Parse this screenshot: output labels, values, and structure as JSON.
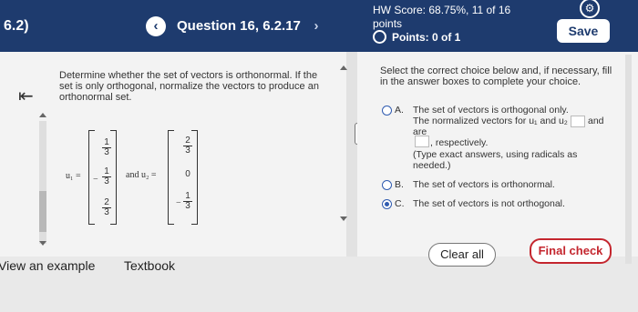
{
  "header": {
    "section_tag": "6.2)",
    "question_title": "Question 16, 6.2.17",
    "prev_label": "‹",
    "next_label": "›",
    "hw_score": "HW Score: 68.75%, 11 of 16 points",
    "points": "Points: 0 of 1",
    "save_label": "Save"
  },
  "left": {
    "instruction": "Determine whether the set of vectors is orthonormal. If the set is only orthogonal, normalize the vectors to produce an orthonormal set.",
    "u1_label": "u₁ =",
    "and_label": "and u₂ =",
    "u1": [
      {
        "sign": "",
        "num": "1",
        "den": "3"
      },
      {
        "sign": "−",
        "num": "1",
        "den": "3"
      },
      {
        "sign": "",
        "num": "2",
        "den": "3"
      }
    ],
    "u2": [
      {
        "sign": "",
        "num": "2",
        "den": "3"
      },
      {
        "sign": "",
        "num": "0",
        "den": ""
      },
      {
        "sign": "−",
        "num": "1",
        "den": "3"
      }
    ],
    "view_example": "View an example",
    "textbook": "Textbook"
  },
  "right": {
    "intro": "Select the correct choice below and, if necessary, fill in the answer boxes to complete your choice.",
    "option_a_letter": "A.",
    "option_a_text": "The set of vectors is orthogonal only. The normalized vectors for u₁ and u₂ are",
    "option_a_and": "and",
    "option_a_resp": ", respectively.",
    "option_a_hint": "(Type exact answers, using radicals as needed.)",
    "option_b_letter": "B.",
    "option_b_text": "The set of vectors is orthonormal.",
    "option_c_letter": "C.",
    "option_c_text": "The set of vectors is not orthogonal.",
    "selected_option": "C"
  },
  "footer": {
    "clear_all": "Clear all",
    "final_check": "Final check"
  },
  "colors": {
    "header_bg": "#1e3b6e",
    "accent_red": "#c4262e",
    "radio_blue": "#2f5bb0"
  }
}
